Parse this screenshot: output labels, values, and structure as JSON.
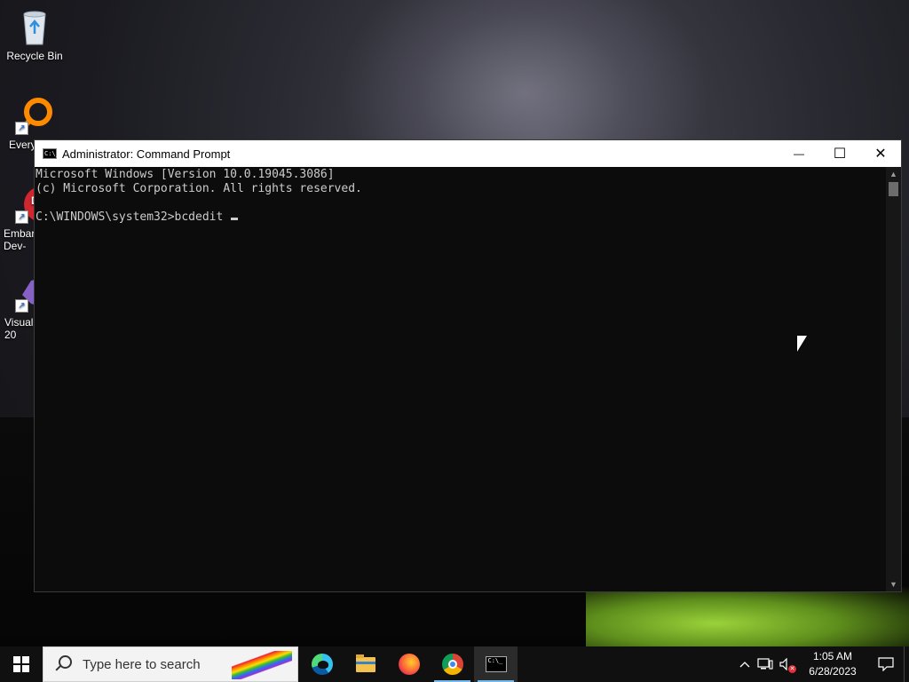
{
  "desktop": {
    "icons": [
      {
        "label": "Recycle Bin"
      },
      {
        "label": "Every"
      },
      {
        "label": "Embar\nDev-"
      },
      {
        "label": "Visual\n20"
      }
    ]
  },
  "window": {
    "title": "Administrator: Command Prompt",
    "controls": {
      "minimize": "—",
      "maximize": "☐",
      "close": "✕"
    },
    "console_lines": [
      "Microsoft Windows [Version 10.0.19045.3086]",
      "(c) Microsoft Corporation. All rights reserved.",
      "",
      "C:\\WINDOWS\\system32>bcdedit "
    ]
  },
  "taskbar": {
    "search": {
      "placeholder": "Type here to search"
    },
    "apps": [
      {
        "name": "edge-icon"
      },
      {
        "name": "file-explorer-icon"
      },
      {
        "name": "firefox-icon"
      },
      {
        "name": "chrome-icon"
      },
      {
        "name": "command-prompt-icon"
      }
    ],
    "tray": {
      "time": "1:05 AM",
      "date": "6/28/2023"
    }
  }
}
